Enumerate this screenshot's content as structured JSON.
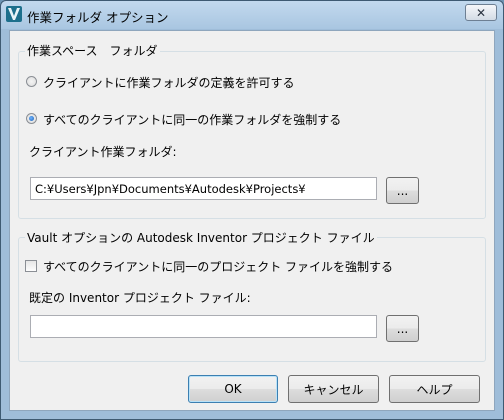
{
  "window": {
    "title": "作業フォルダ オプション",
    "close_glyph": "✕"
  },
  "workspace_group": {
    "label": "作業スペース　フォルダ",
    "radio_allow_client": {
      "label": "クライアントに作業フォルダの定義を許可する",
      "selected": false
    },
    "radio_enforce_same": {
      "label": "すべてのクライアントに同一の作業フォルダを強制する",
      "selected": true
    },
    "client_folder_label": "クライアント作業フォルダ:",
    "client_folder_value": "C:¥Users¥Jpn¥Documents¥Autodesk¥Projects¥",
    "browse_label": "..."
  },
  "vault_group": {
    "label": "Vault オプションの Autodesk Inventor プロジェクト ファイル",
    "checkbox_enforce_project": {
      "label": "すべてのクライアントに同一のプロジェクト ファイルを強制する",
      "checked": false
    },
    "default_project_label": "既定の Inventor プロジェクト ファイル:",
    "default_project_value": "",
    "browse_label": "..."
  },
  "buttons": {
    "ok": "OK",
    "cancel": "キャンセル",
    "help": "ヘルプ"
  },
  "icons": {
    "app": "autodesk-vault-icon",
    "close": "close-icon"
  },
  "colors": {
    "titlebar": "#a9c6e1",
    "dialog_bg": "#f0f0f0",
    "default_button_border": "#3c7fb1"
  }
}
